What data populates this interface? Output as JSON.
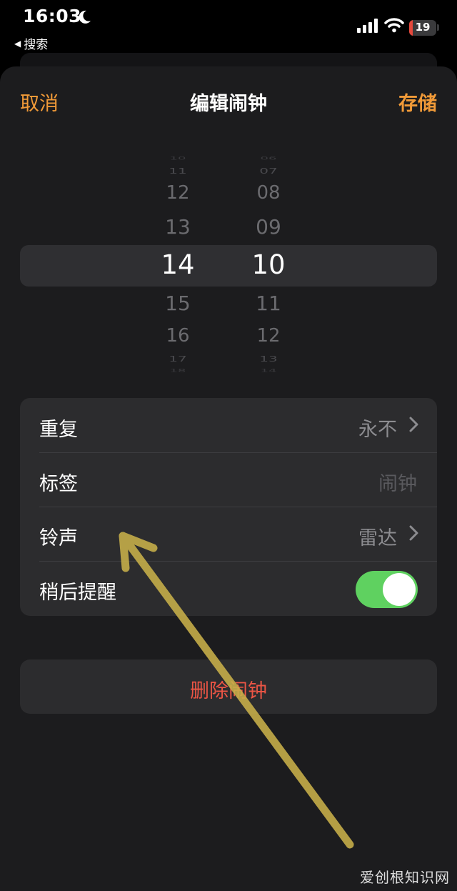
{
  "status_bar": {
    "time": "16:03",
    "back_label": "搜索",
    "battery_level": "19",
    "icons": [
      "moon-icon",
      "signal-icon",
      "wifi-icon",
      "battery-icon"
    ]
  },
  "nav": {
    "cancel": "取消",
    "title": "编辑闹钟",
    "save": "存储"
  },
  "picker": {
    "hours": {
      "edge_top": "10",
      "above2": "11",
      "above1": "12",
      "near_above": "13",
      "selected": "14",
      "near_below": "15",
      "below1": "16",
      "below2": "17",
      "edge_bottom": "18"
    },
    "minutes": {
      "edge_top": "06",
      "above2": "07",
      "above1": "08",
      "near_above": "09",
      "selected": "10",
      "near_below": "11",
      "below1": "12",
      "below2": "13",
      "edge_bottom": "14"
    }
  },
  "settings": {
    "repeat": {
      "label": "重复",
      "value": "永不"
    },
    "label": {
      "label": "标签",
      "placeholder": "闹钟"
    },
    "sound": {
      "label": "铃声",
      "value": "雷达"
    },
    "snooze": {
      "label": "稍后提醒",
      "enabled": true
    }
  },
  "delete_button": "删除闹钟",
  "watermark": "爱创根知识网",
  "colors": {
    "accent": "#f19a38",
    "destructive": "#eb5545",
    "toggle_on": "#5fd160",
    "arrow": "#c9b04a"
  }
}
